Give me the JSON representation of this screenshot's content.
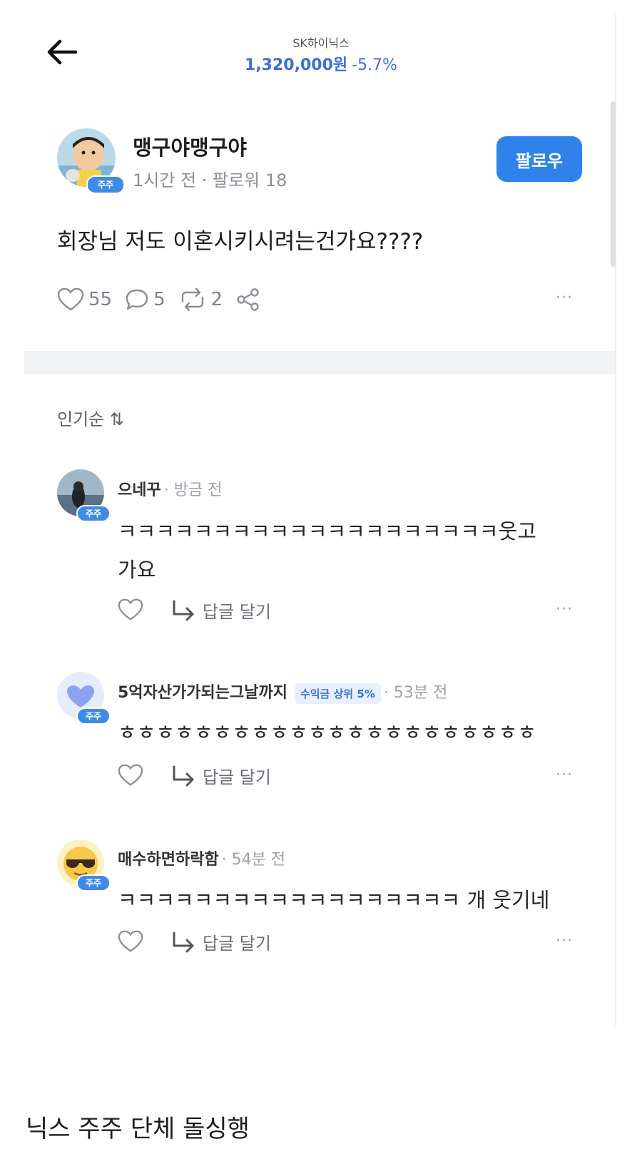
{
  "header": {
    "stock_name": "SK하이닉스",
    "price": "1,320,000원",
    "change": "-5.7%"
  },
  "post": {
    "author": "맹구야맹구야",
    "badge": "주주",
    "meta": "1시간 전 · 팔로워 18",
    "follow_label": "팔로우",
    "content": "회장님 저도 이혼시키시려는건가요????",
    "likes": "55",
    "comments": "5",
    "reposts": "2",
    "more": "···"
  },
  "sort": {
    "label": "인기순 ⇅"
  },
  "comments": [
    {
      "name": "으네꾸",
      "time": "· 방금 전",
      "badge": "주주",
      "text_line1": "ㅋㅋㅋㅋㅋㅋㅋㅋㅋㅋㅋㅋㅋㅋㅋㅋㅋㅋㅋㅋ웃고",
      "text_line2": "가요",
      "reply_label": "답글 달기",
      "more": "···"
    },
    {
      "name": "5억자산가가되는그날까지",
      "tag": "수익금 상위 5%",
      "time": "· 53분 전",
      "badge": "주주",
      "text_line1": "ㅎㅎㅎㅎㅎㅎㅎㅎㅎㅎㅎㅎㅎㅎㅎㅎㅎㅎㅎㅎㅎㅎ",
      "reply_label": "답글 달기",
      "more": "···"
    },
    {
      "name": "매수하면하락함",
      "time": "· 54분 전",
      "badge": "주주",
      "text_line1": "ㅋㅋㅋㅋㅋㅋㅋㅋㅋㅋㅋㅋㅋㅋㅋㅋㅋㅋ 개 웃기네",
      "reply_label": "답글 달기",
      "more": "···"
    }
  ],
  "caption": "닉스 주주 단체 돌싱행",
  "colors": {
    "accent": "#3c6fd8",
    "follow_button": "#2f82ea",
    "badge": "#3f8ae6"
  }
}
